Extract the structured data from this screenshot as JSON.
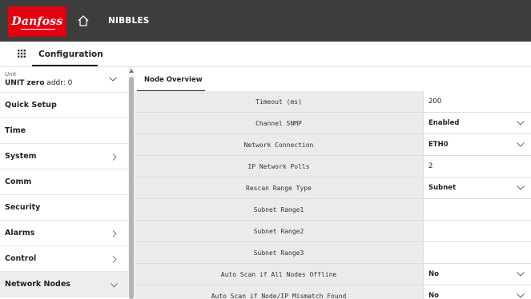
{
  "header": {
    "brand": "Danfoss",
    "app_name": "NIBBLES",
    "colors": {
      "topbar": "#3d3d3d",
      "brand_red": "#e2000f"
    }
  },
  "tabrow": {
    "configuration": "Configuration"
  },
  "unit": {
    "label": "Unit",
    "name": "UNIT zero",
    "addr": " addr: 0"
  },
  "sidebar": {
    "items": [
      {
        "label": "Quick Setup",
        "arrow": "none"
      },
      {
        "label": "Time",
        "arrow": "none"
      },
      {
        "label": "System",
        "arrow": "right"
      },
      {
        "label": "Comm",
        "arrow": "none"
      },
      {
        "label": "Security",
        "arrow": "none"
      },
      {
        "label": "Alarms",
        "arrow": "right"
      },
      {
        "label": "Control",
        "arrow": "right"
      },
      {
        "label": "Network Nodes",
        "arrow": "down",
        "active": true
      }
    ]
  },
  "main": {
    "tab": "Node Overview",
    "rows": [
      {
        "label": "Timeout (ms)",
        "value": "200",
        "kind": "text"
      },
      {
        "label": "Channel SNMP",
        "value": "Enabled",
        "kind": "select"
      },
      {
        "label": "Network Connection",
        "value": "ETH0",
        "kind": "select"
      },
      {
        "label": "IP Network Polls",
        "value": "2",
        "kind": "text"
      },
      {
        "label": "Rescan Range Type",
        "value": "Subnet",
        "kind": "select"
      },
      {
        "label": "Subnet Range1",
        "value": "",
        "kind": "text"
      },
      {
        "label": "Subnet Range2",
        "value": "",
        "kind": "text"
      },
      {
        "label": "Subnet Range3",
        "value": "",
        "kind": "text"
      },
      {
        "label": "Auto Scan if All Nodes Offline",
        "value": "No",
        "kind": "select"
      },
      {
        "label": "Auto Scan if Node/IP Mismatch Found",
        "value": "No",
        "kind": "select"
      }
    ]
  }
}
